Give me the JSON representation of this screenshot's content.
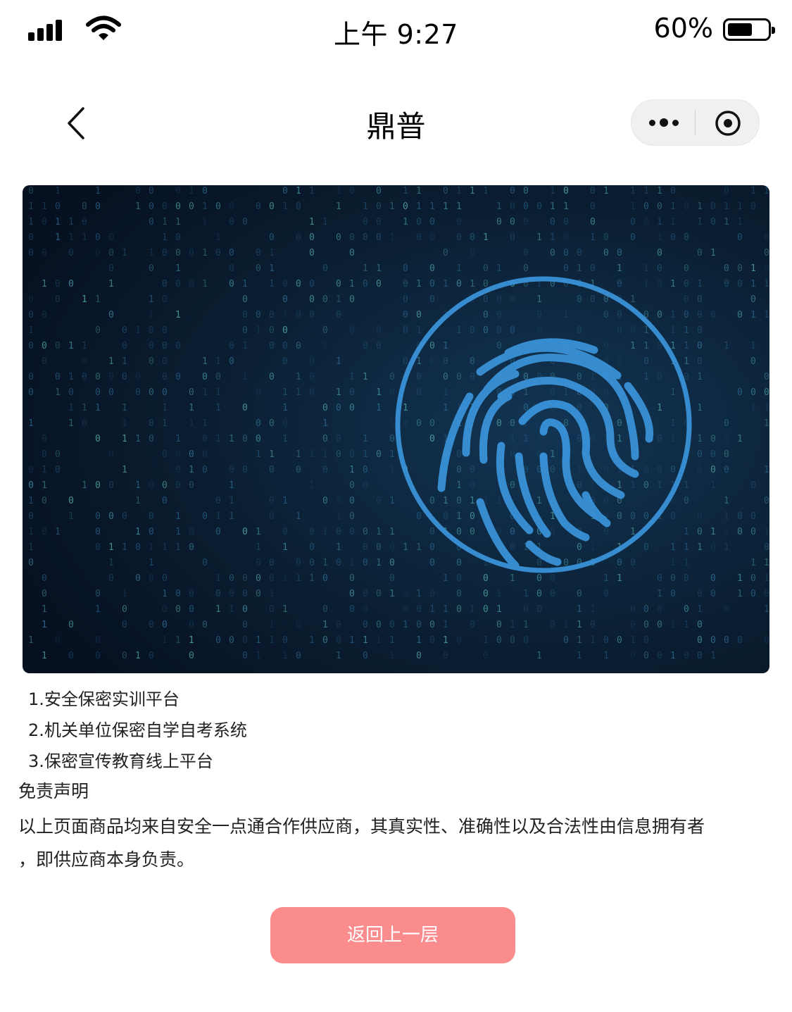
{
  "status_bar": {
    "time": "上午 9:27",
    "battery_percent": "60%",
    "battery_level": 0.6
  },
  "navbar": {
    "title": "鼎普",
    "back_icon": "chevron-left-icon",
    "more_icon": "more-dots-icon",
    "close_icon": "target-circle-icon"
  },
  "banner": {
    "image": "fingerprint-digital-banner",
    "colors": {
      "background": "#0b1a2b",
      "accent": "#2f8fd6"
    }
  },
  "features": [
    "1.安全保密实训平台",
    "2.机关单位保密自学自考系统",
    "3.保密宣传教育线上平台"
  ],
  "disclaimer": {
    "title": "免责声明",
    "line1": "以上页面商品均来自安全一点通合作供应商，其真实性、准确性以及合法性由信息拥有者",
    "line2": "，即供应商本身负责。"
  },
  "back_button": {
    "label": "返回上一层",
    "color": "#fa8c8e"
  }
}
